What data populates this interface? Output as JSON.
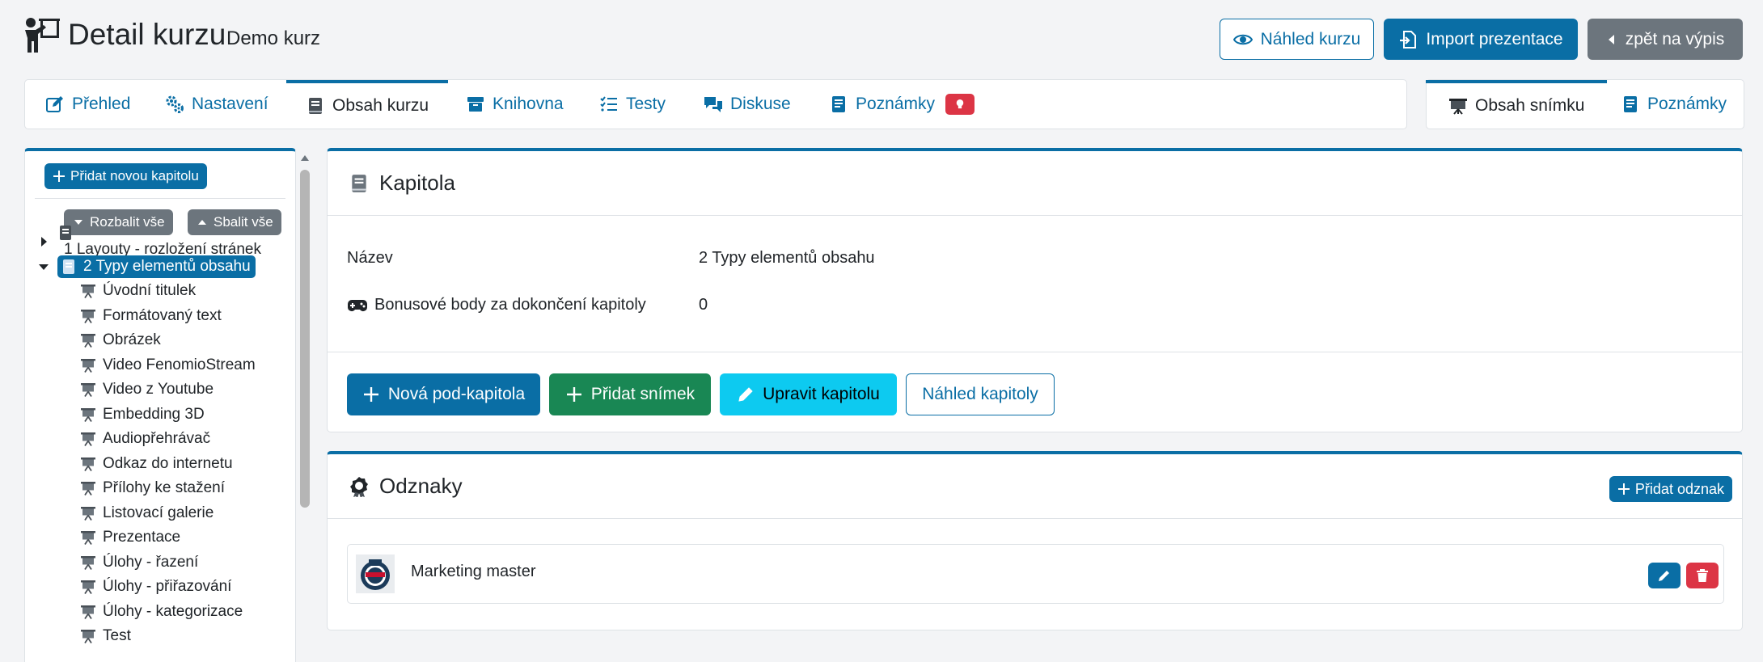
{
  "header": {
    "title": "Detail kurzu",
    "subtitle": "Demo kurz",
    "preview_button": "Náhled kurzu",
    "import_button": "Import prezentace",
    "back_button": "zpět na výpis"
  },
  "tabs": [
    {
      "label": "Přehled",
      "icon": "edit-icon"
    },
    {
      "label": "Nastavení",
      "icon": "gears-icon"
    },
    {
      "label": "Obsah kurzu",
      "icon": "book-icon",
      "active": true
    },
    {
      "label": "Knihovna",
      "icon": "archive-icon"
    },
    {
      "label": "Testy",
      "icon": "list-check-icon"
    },
    {
      "label": "Diskuse",
      "icon": "comments-icon"
    },
    {
      "label": "Poznámky",
      "icon": "notes-icon"
    }
  ],
  "side_tabs": [
    {
      "label": "Obsah snímku",
      "icon": "presentation-icon",
      "active": true
    },
    {
      "label": "Poznámky",
      "icon": "notes-icon"
    }
  ],
  "tree": {
    "add_chapter": "Přidat novou kapitolu",
    "expand_all": "Rozbalit vše",
    "collapse_all": "Sbalit vše",
    "chapters": [
      {
        "label": "1 Layouty - rozložení stránek",
        "expanded": false
      },
      {
        "label": "2 Typy elementů obsahu",
        "expanded": true,
        "selected": true
      }
    ],
    "slides": [
      "Úvodní titulek",
      "Formátovaný text",
      "Obrázek",
      "Video FenomioStream",
      "Video z Youtube",
      "Embedding 3D",
      "Audiopřehrávač",
      "Odkaz do internetu",
      "Přílohy ke stažení",
      "Listovací galerie",
      "Prezentace",
      "Úlohy - řazení",
      "Úlohy - přiřazování",
      "Úlohy - kategorizace",
      "Test"
    ]
  },
  "chapter_card": {
    "title": "Kapitola",
    "name_label": "Název",
    "name_value": "2 Typy elementů obsahu",
    "bonus_label": "Bonusové body za dokončení kapitoly",
    "bonus_value": "0",
    "btn_new_sub": "Nová pod-kapitola",
    "btn_add_slide": "Přidat snímek",
    "btn_edit": "Upravit kapitolu",
    "btn_preview": "Náhled kapitoly"
  },
  "badges_card": {
    "title": "Odznaky",
    "add_button": "Přidat odznak",
    "items": [
      {
        "name": "Marketing master"
      }
    ]
  },
  "colors": {
    "primary": "#0a6ea5",
    "success": "#198754",
    "info": "#0dcaf0",
    "danger": "#dc3545",
    "secondary": "#6c757d"
  }
}
